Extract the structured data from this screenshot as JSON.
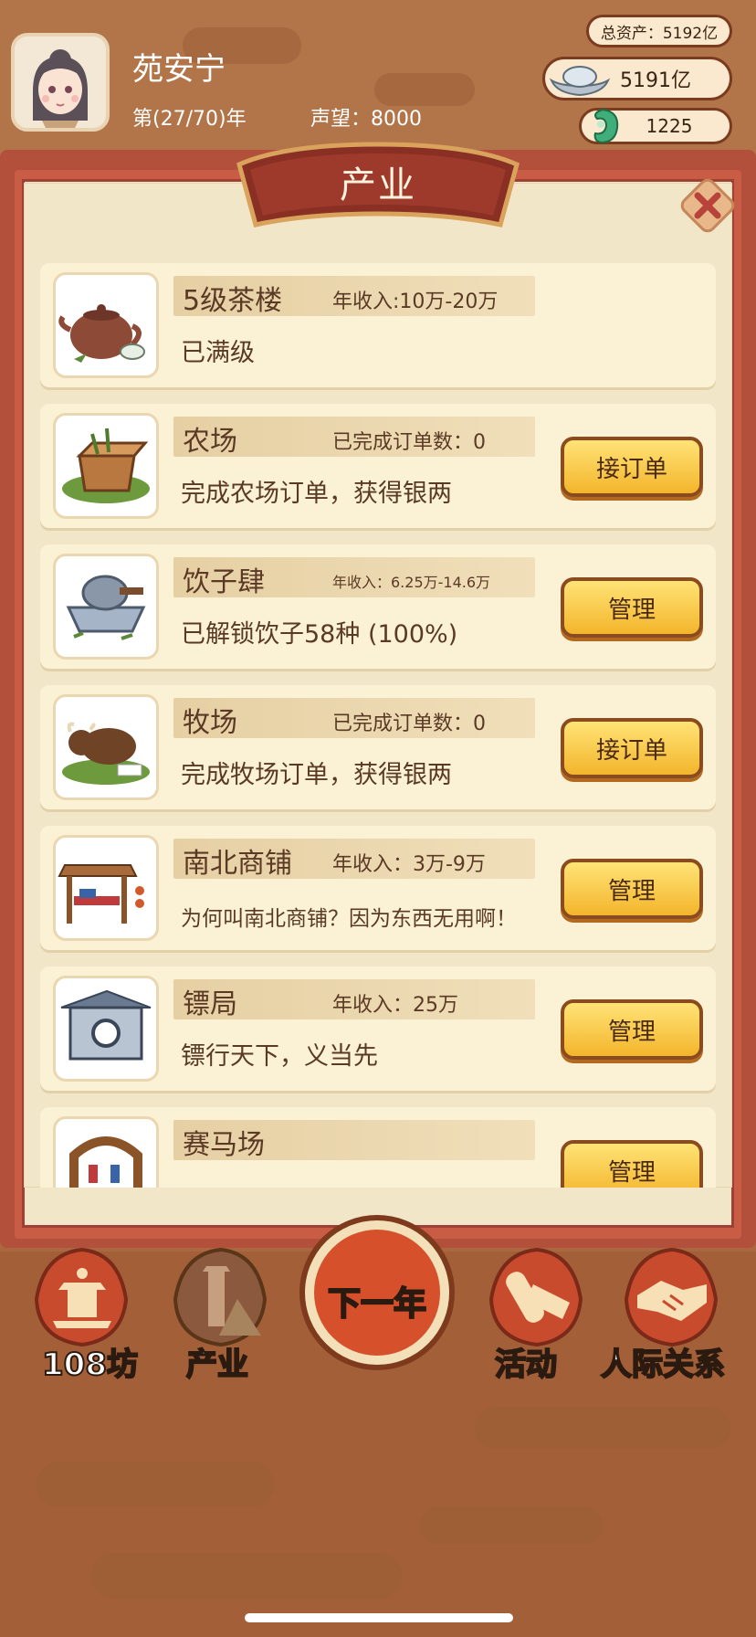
{
  "player": {
    "name": "苑安宁",
    "year": "第(27/70)年",
    "reputation": "声望：8000"
  },
  "resources": {
    "total_assets": "总资产：5192亿",
    "silver": "5191亿",
    "jade": "1225"
  },
  "panel": {
    "title": "产业"
  },
  "industries": [
    {
      "name": "5级茶楼",
      "stat": "年收入:10万-20万",
      "desc": "已满级",
      "button": "",
      "icon": "teapot-icon"
    },
    {
      "name": "农场",
      "stat": "已完成订单数：0",
      "desc": "完成农场订单，获得银两",
      "button": "接订单",
      "icon": "farm-crate-icon"
    },
    {
      "name": "饮子肆",
      "stat": "年收入：6.25万-14.6万",
      "desc": "已解锁饮子58种 (100%)",
      "button": "管理",
      "icon": "grinder-icon"
    },
    {
      "name": "牧场",
      "stat": "已完成订单数：0",
      "desc": "完成牧场订单，获得银两",
      "button": "接订单",
      "icon": "ox-icon"
    },
    {
      "name": "南北商铺",
      "stat": "年收入：3万-9万",
      "desc": "为何叫南北商铺？因为东西无用啊！",
      "button": "管理",
      "icon": "market-stall-icon"
    },
    {
      "name": "镖局",
      "stat": "年收入：25万",
      "desc": "镖行天下，义当先",
      "button": "管理",
      "icon": "escort-gate-icon"
    },
    {
      "name": "赛马场",
      "stat": "",
      "desc": "",
      "button": "管理",
      "icon": "racecourse-gate-icon"
    }
  ],
  "nav": {
    "workshops": "108坊",
    "industry": "产业",
    "next_year": "下一年",
    "activity": "活动",
    "relations": "人际关系"
  },
  "colors": {
    "panel_red": "#c85c45",
    "card_bg": "#fbf2d5",
    "button_gold": "#f3b52c"
  }
}
